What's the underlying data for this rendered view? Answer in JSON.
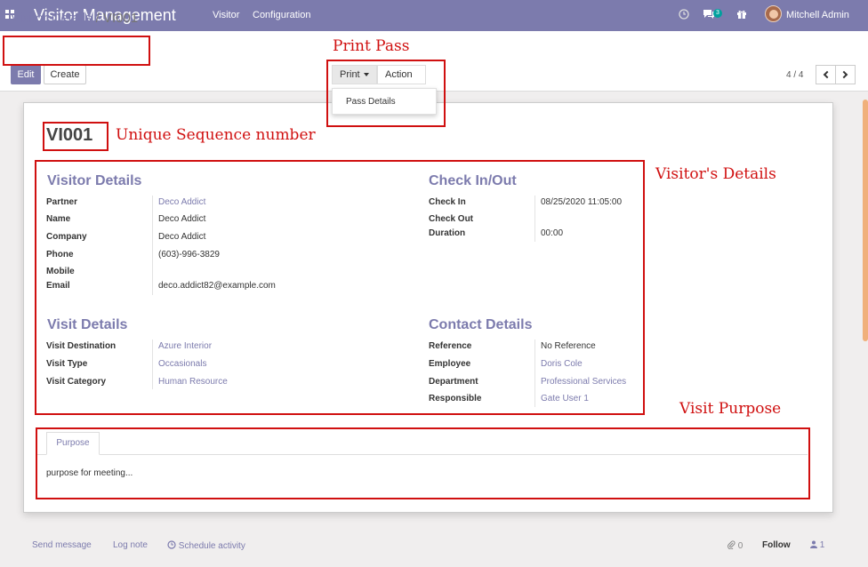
{
  "navbar": {
    "app_title": "Visitor Management",
    "menu": [
      "Visitor",
      "Configuration"
    ],
    "chat_count": "3",
    "user_name": "Mitchell Admin",
    "bg_color": "#7c7bad"
  },
  "breadcrumb": {
    "parent": "Visitor Details",
    "separator": "/",
    "current": "VI001"
  },
  "buttons": {
    "edit": "Edit",
    "create": "Create",
    "print": "Print",
    "action": "Action"
  },
  "print_menu": [
    "Pass Details"
  ],
  "pager": {
    "value": "4 / 4"
  },
  "record": {
    "sequence": "VI001",
    "visitor_details": {
      "title": "Visitor Details",
      "fields": [
        {
          "label": "Partner",
          "value": "Deco Addict"
        },
        {
          "label": "Name",
          "value": "Deco Addict"
        },
        {
          "label": "Company",
          "value": "Deco Addict"
        },
        {
          "label": "Phone",
          "value": "(603)-996-3829"
        },
        {
          "label": "Mobile",
          "value": ""
        },
        {
          "label": "Email",
          "value": "deco.addict82@example.com"
        }
      ]
    },
    "check_in_out": {
      "title": "Check In/Out",
      "fields": [
        {
          "label": "Check In",
          "value": "08/25/2020 11:05:00"
        },
        {
          "label": "Check Out",
          "value": ""
        },
        {
          "label": "Duration",
          "value": "00:00"
        }
      ]
    },
    "visit_details": {
      "title": "Visit Details",
      "fields": [
        {
          "label": "Visit Destination",
          "value": "Azure Interior"
        },
        {
          "label": "Visit Type",
          "value": "Occasionals"
        },
        {
          "label": "Visit Category",
          "value": "Human Resource"
        }
      ]
    },
    "contact_details": {
      "title": "Contact Details",
      "fields": [
        {
          "label": "Reference",
          "value": "No Reference"
        },
        {
          "label": "Employee",
          "value": "Doris Cole"
        },
        {
          "label": "Department",
          "value": "Professional Services"
        },
        {
          "label": "Responsible",
          "value": "Gate User 1"
        }
      ]
    },
    "tabs": [
      "Purpose"
    ],
    "purpose_text": "purpose for meeting..."
  },
  "chatter": {
    "send_message": "Send message",
    "log_note": "Log note",
    "schedule_activity": "Schedule activity",
    "attachments": "0",
    "follow": "Follow",
    "followers": "1"
  },
  "annotations": {
    "print_pass": "Print Pass",
    "unique_sequence": "Unique Sequence number",
    "visitors_details": "Visitor's Details",
    "visit_purpose": "Visit Purpose",
    "color": "#d01010"
  }
}
